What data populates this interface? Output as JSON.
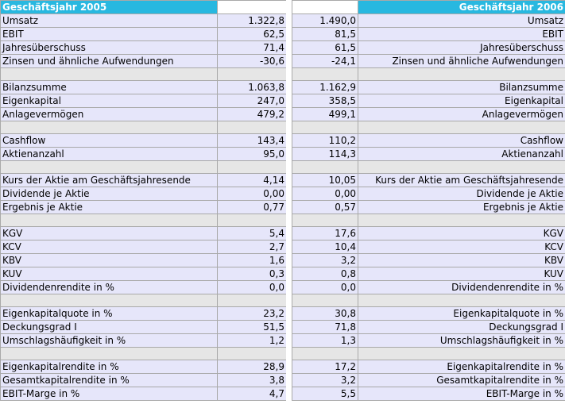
{
  "left_header": "Geschäftsjahr 2005",
  "right_header": "Geschäftsjahr 2006",
  "groups": [
    {
      "rows": [
        {
          "label": "Umsatz",
          "v2005": "1.322,8",
          "v2006": "1.490,0"
        },
        {
          "label": "EBIT",
          "v2005": "62,5",
          "v2006": "81,5"
        },
        {
          "label": "Jahresüberschuss",
          "v2005": "71,4",
          "v2006": "61,5"
        },
        {
          "label": "Zinsen und ähnliche Aufwendungen",
          "v2005": "-30,6",
          "v2006": "-24,1"
        }
      ]
    },
    {
      "rows": [
        {
          "label": "Bilanzsumme",
          "v2005": "1.063,8",
          "v2006": "1.162,9"
        },
        {
          "label": "Eigenkapital",
          "v2005": "247,0",
          "v2006": "358,5"
        },
        {
          "label": "Anlagevermögen",
          "v2005": "479,2",
          "v2006": "499,1"
        }
      ]
    },
    {
      "rows": [
        {
          "label": "Cashflow",
          "v2005": "143,4",
          "v2006": "110,2"
        },
        {
          "label": "Aktienanzahl",
          "v2005": "95,0",
          "v2006": "114,3"
        }
      ]
    },
    {
      "rows": [
        {
          "label": "Kurs der Aktie am Geschäftsjahresende",
          "v2005": "4,14",
          "v2006": "10,05"
        },
        {
          "label": "Dividende je Aktie",
          "v2005": "0,00",
          "v2006": "0,00"
        },
        {
          "label": "Ergebnis je Aktie",
          "v2005": "0,77",
          "v2006": "0,57"
        }
      ]
    },
    {
      "rows": [
        {
          "label": "KGV",
          "v2005": "5,4",
          "v2006": "17,6"
        },
        {
          "label": "KCV",
          "v2005": "2,7",
          "v2006": "10,4"
        },
        {
          "label": "KBV",
          "v2005": "1,6",
          "v2006": "3,2"
        },
        {
          "label": "KUV",
          "v2005": "0,3",
          "v2006": "0,8"
        },
        {
          "label": "Dividendenrendite in %",
          "v2005": "0,0",
          "v2006": "0,0"
        }
      ]
    },
    {
      "rows": [
        {
          "label": "Eigenkapitalquote in %",
          "v2005": "23,2",
          "v2006": "30,8"
        },
        {
          "label": "Deckungsgrad I",
          "v2005": "51,5",
          "v2006": "71,8"
        },
        {
          "label": "Umschlagshäufigkeit in %",
          "v2005": "1,2",
          "v2006": "1,3"
        }
      ]
    },
    {
      "rows": [
        {
          "label": "Eigenkapitalrendite in %",
          "v2005": "28,9",
          "v2006": "17,2"
        },
        {
          "label": "Gesamtkapitalrendite in %",
          "v2005": "3,8",
          "v2006": "3,2"
        },
        {
          "label": "EBIT-Marge in %",
          "v2005": "4,7",
          "v2006": "5,5"
        }
      ]
    }
  ]
}
